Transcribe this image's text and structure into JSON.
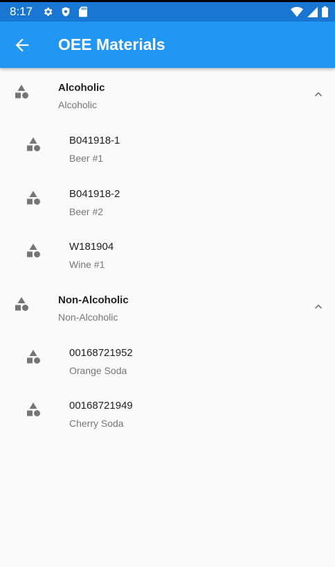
{
  "status_bar": {
    "time": "8:17",
    "icons_left": [
      "gear-icon",
      "shield-icon",
      "sd-card-icon"
    ],
    "icons_right": [
      "wifi-icon",
      "signal-icon",
      "battery-icon"
    ]
  },
  "app_bar": {
    "title": "OEE Materials",
    "back_icon": "arrow-back-icon",
    "background": "#2196f3"
  },
  "groups": [
    {
      "title": "Alcoholic",
      "subtitle": "Alcoholic",
      "expanded": true,
      "items": [
        {
          "title": "B041918-1",
          "subtitle": "Beer #1"
        },
        {
          "title": "B041918-2",
          "subtitle": "Beer #2"
        },
        {
          "title": "W181904",
          "subtitle": "Wine #1"
        }
      ]
    },
    {
      "title": "Non-Alcoholic",
      "subtitle": "Non-Alcoholic",
      "expanded": true,
      "items": [
        {
          "title": "00168721952",
          "subtitle": "Orange Soda"
        },
        {
          "title": "00168721949",
          "subtitle": "Cherry Soda"
        }
      ]
    }
  ]
}
